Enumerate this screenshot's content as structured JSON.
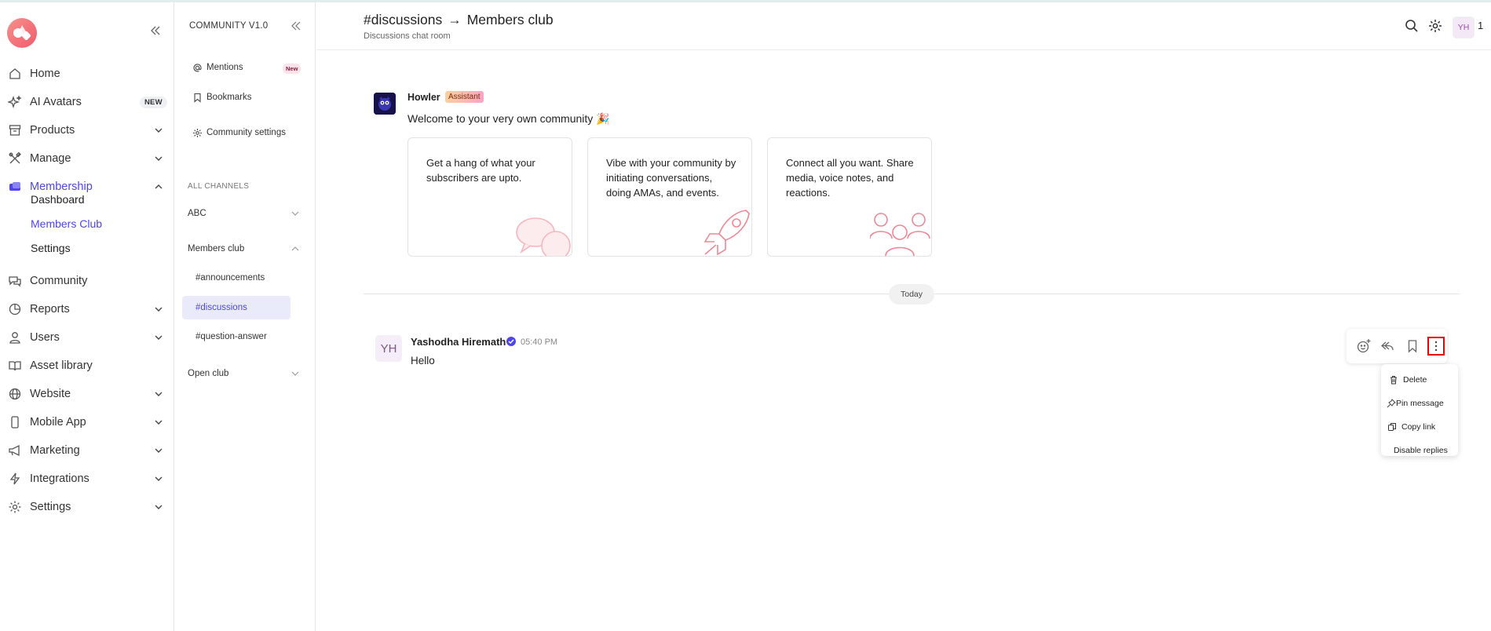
{
  "colors": {
    "accent": "#4f46e5",
    "brand_gradient": [
      "#f7918a",
      "#f05a6e"
    ],
    "highlight_border": "#e00000"
  },
  "sidebar": {
    "items": [
      {
        "label": "Home",
        "icon": "home-icon"
      },
      {
        "label": "AI Avatars",
        "icon": "sparkles-icon",
        "badge": "NEW"
      },
      {
        "label": "Products",
        "icon": "box-icon"
      },
      {
        "label": "Manage",
        "icon": "tools-icon"
      },
      {
        "label": "Membership",
        "icon": "ticket-icon"
      },
      {
        "label": "Community",
        "icon": "chat-icon"
      },
      {
        "label": "Reports",
        "icon": "pie-chart-icon"
      },
      {
        "label": "Users",
        "icon": "user-icon"
      },
      {
        "label": "Asset library",
        "icon": "book-icon"
      },
      {
        "label": "Website",
        "icon": "globe-icon"
      },
      {
        "label": "Mobile App",
        "icon": "phone-icon"
      },
      {
        "label": "Marketing",
        "icon": "megaphone-icon"
      },
      {
        "label": "Integrations",
        "icon": "lightning-icon"
      },
      {
        "label": "Settings",
        "icon": "gear-icon"
      }
    ],
    "membership_sub": [
      "Dashboard",
      "Members Club",
      "Settings"
    ]
  },
  "community_panel": {
    "title": "COMMUNITY V1.0",
    "links": {
      "mentions": "Mentions",
      "mentions_badge": "New",
      "bookmarks": "Bookmarks",
      "settings": "Community settings"
    },
    "section_label": "ALL CHANNELS",
    "groups": [
      "ABC",
      "Members club",
      "Open club"
    ],
    "channels": [
      "#announcements",
      "#discussions",
      "#question-answer"
    ]
  },
  "header": {
    "channel": "#discussions",
    "arrow": "→",
    "club": "Members club",
    "subtitle": "Discussions chat room",
    "avatar_initials": "YH",
    "count": "1"
  },
  "bot": {
    "name": "Howler",
    "badge": "Assistant",
    "message": "Welcome to your very own community 🎉",
    "cards": [
      "Get a hang of what your subscribers are upto.",
      "Vibe with your community by initiating conversations, doing AMAs, and events.",
      "Connect all you want. Share media, voice notes, and reactions."
    ]
  },
  "divider_label": "Today",
  "message": {
    "initials": "YH",
    "author": "Yashodha Hiremath",
    "time": "05:40 PM",
    "text": "Hello"
  },
  "context_menu": {
    "delete": "Delete",
    "pin": "Pin message",
    "copy": "Copy link",
    "disable": "Disable replies"
  }
}
